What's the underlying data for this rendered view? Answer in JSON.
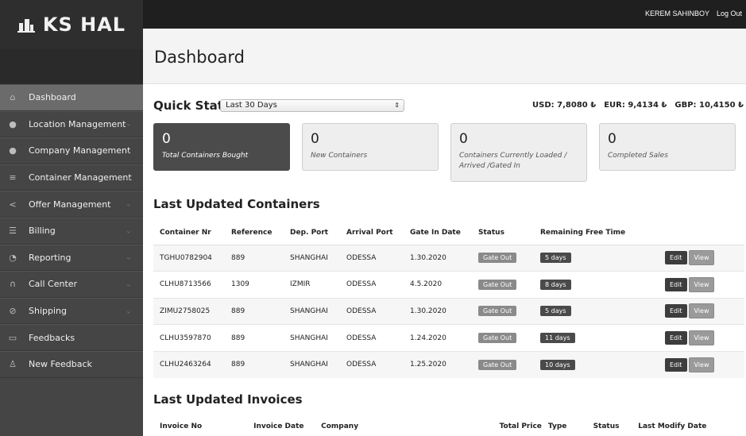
{
  "logo": {
    "text": "KS HAL",
    "icon": "building-icon"
  },
  "topbar": {
    "user": "KEREM SAHINBOY",
    "logout": "Log Out"
  },
  "header": {
    "title": "Dashboard"
  },
  "sidebar": {
    "items": [
      {
        "label": "Dashboard",
        "icon": "home-icon",
        "active": true,
        "has_chevron": false
      },
      {
        "label": "Location Management",
        "icon": "location-pin-icon",
        "active": false,
        "has_chevron": true
      },
      {
        "label": "Company Management",
        "icon": "user-icon",
        "active": false,
        "has_chevron": true
      },
      {
        "label": "Container Management",
        "icon": "database-icon",
        "active": false,
        "has_chevron": true
      },
      {
        "label": "Offer Management",
        "icon": "share-icon",
        "active": false,
        "has_chevron": true
      },
      {
        "label": "Billing",
        "icon": "list-icon",
        "active": false,
        "has_chevron": true
      },
      {
        "label": "Reporting",
        "icon": "chart-icon",
        "active": false,
        "has_chevron": true
      },
      {
        "label": "Call Center",
        "icon": "headset-icon",
        "active": false,
        "has_chevron": true
      },
      {
        "label": "Shipping",
        "icon": "compass-icon",
        "active": false,
        "has_chevron": true
      },
      {
        "label": "Feedbacks",
        "icon": "comment-icon",
        "active": false,
        "has_chevron": false
      },
      {
        "label": "New Feedback",
        "icon": "person-icon",
        "active": false,
        "has_chevron": false
      }
    ]
  },
  "quick_stats": {
    "title": "Quick Stats",
    "period": "Last 30 Days",
    "rates": [
      "USD: 7,8080 ₺",
      "EUR: 9,4134 ₺",
      "GBP: 10,4150 ₺"
    ],
    "cards": [
      {
        "value": "0",
        "label": "Total Containers Bought"
      },
      {
        "value": "0",
        "label": "New Containers"
      },
      {
        "value": "0",
        "label": "Containers Currently Loaded / Arrived /Gated In"
      },
      {
        "value": "0",
        "label": "Completed Sales"
      }
    ]
  },
  "containers": {
    "title": "Last Updated Containers",
    "headers": [
      "Container Nr",
      "Reference",
      "Dep. Port",
      "Arrival Port",
      "Gate In Date",
      "Status",
      "Remaining Free Time"
    ],
    "rows": [
      [
        "TGHU0782904",
        "889",
        "SHANGHAI",
        "ODESSA",
        "1.30.2020",
        "Gate Out",
        "5 days"
      ],
      [
        "CLHU8713566",
        "1309",
        "IZMIR",
        "ODESSA",
        "4.5.2020",
        "Gate Out",
        "8 days"
      ],
      [
        "ZIMU2758025",
        "889",
        "SHANGHAI",
        "ODESSA",
        "1.30.2020",
        "Gate Out",
        "5 days"
      ],
      [
        "CLHU3597870",
        "889",
        "SHANGHAI",
        "ODESSA",
        "1.24.2020",
        "Gate Out",
        "11 days"
      ],
      [
        "CLHU2463264",
        "889",
        "SHANGHAI",
        "ODESSA",
        "1.25.2020",
        "Gate Out",
        "10 days"
      ]
    ],
    "edit_label": "Edit",
    "view_label": "View"
  },
  "invoices": {
    "title": "Last Updated Invoices",
    "headers": [
      "Invoice No",
      "Invoice Date",
      "Company",
      "Total Price",
      "Type",
      "Status",
      "Last Modify Date"
    ]
  }
}
